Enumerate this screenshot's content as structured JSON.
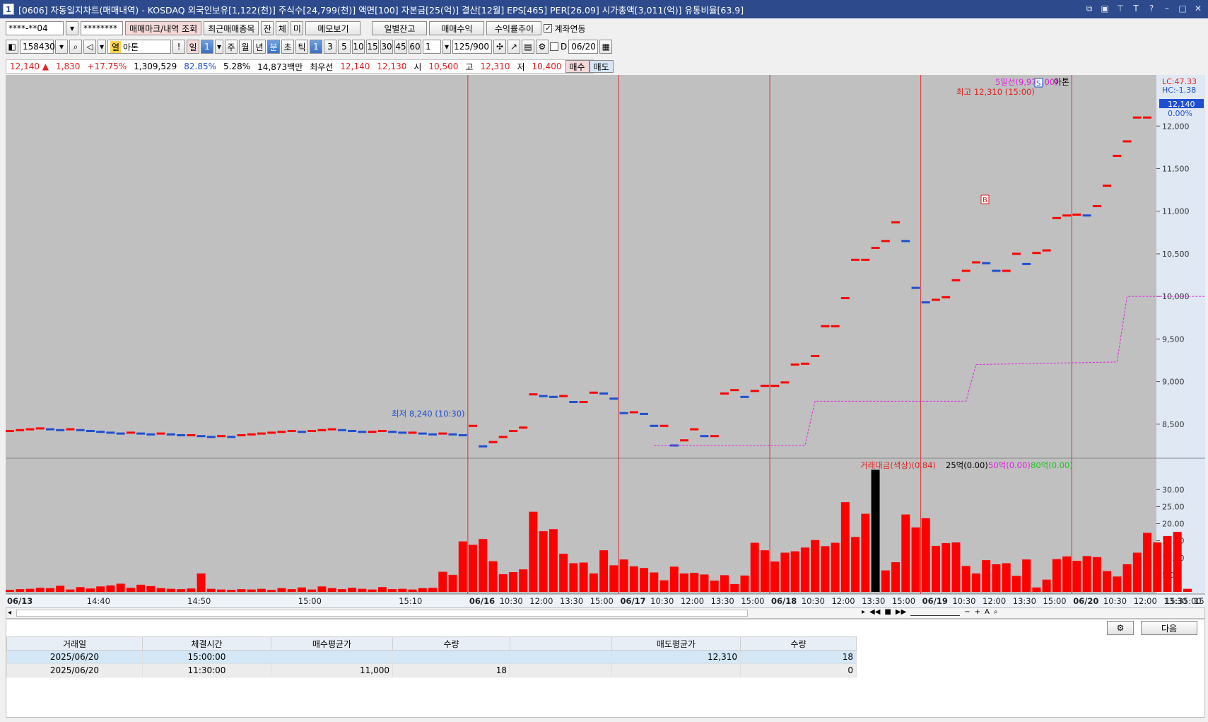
{
  "window": {
    "title": "[0606] 자동일지차트(매매내역) - KOSDAQ 외국인보유[1,122(천)] 주식수[24,799(천)] 액면[100] 자본금[25(억)] 결산[12월] EPS[465] PER[26.09] 시가총액[3,011(억)] 유통비율[63.9]",
    "icon_text": "1"
  },
  "toolbar1": {
    "account": "****-**04",
    "password": "********",
    "query_btn": "매매마크/내역 조회",
    "recent_btn": "최근매매종목",
    "jan_btn": "잔",
    "che_btn": "체",
    "mi_btn": "미",
    "memo_btn": "메모보기",
    "daily_balance_btn": "일별잔고",
    "trade_profit_btn": "매매수익",
    "return_trend_btn": "수익률추이",
    "account_link_label": "계좌연동"
  },
  "toolbar2": {
    "code": "158430",
    "name": "아톤",
    "name_prefix": "열",
    "day_label": "일",
    "period_num": "1",
    "week": "주",
    "month": "월",
    "year": "년",
    "minute": "분",
    "second": "초",
    "tick": "틱",
    "intervals": [
      "1",
      "3",
      "5",
      "10",
      "15",
      "30",
      "45",
      "60"
    ],
    "count": "1",
    "bars": "125/900",
    "date_prefix": "D",
    "date": "06/20"
  },
  "quote": {
    "price": "12,140 ▲",
    "change": "1,830",
    "pct": "+17.75%",
    "volume": "1,309,529",
    "ratio1": "82.85%",
    "ratio2": "5.28%",
    "amount": "14,873백만",
    "best_label": "최우선",
    "ask": "12,140",
    "bid": "12,130",
    "open_label": "시",
    "open": "10,500",
    "high_label": "고",
    "high": "12,310",
    "low_label": "저",
    "low": "10,400",
    "buy_btn": "매수",
    "sell_btn": "매도"
  },
  "chart_data": {
    "type": "candlestick",
    "x_labels": [
      "06/13",
      "14:40",
      "14:50",
      "15:00",
      "15:10",
      "06/16",
      "10:30",
      "12:00",
      "13:30",
      "15:00",
      "06/17",
      "10:30",
      "12:00",
      "13:30",
      "15:00",
      "06/18",
      "10:30",
      "12:00",
      "13:30",
      "15:00",
      "06/19",
      "10:30",
      "12:00",
      "13:30",
      "15:00",
      "06/20",
      "10:30",
      "12:00",
      "13:30",
      "15:00",
      "15:35:00"
    ],
    "price_axis": {
      "ticks": [
        "12,000",
        "11,500",
        "11,000",
        "10,500",
        "10,000",
        "9,500",
        "9,000",
        "8,500"
      ],
      "min": 8150,
      "max": 12550
    },
    "price_tag": "12,140",
    "price_tag_pct": "0.00%",
    "legend_ma": "5일선(9,972.00)",
    "legend_name": "아톤",
    "lc": "LC:47.33",
    "hc": "HC:-1.38",
    "high_label": "최고 12,310 (15:00)",
    "low_label": "최저 8,240 (10:30)",
    "buy_marker": "B",
    "sell_marker": "S",
    "price_series": [
      8420,
      8430,
      8440,
      8450,
      8440,
      8430,
      8440,
      8430,
      8420,
      8410,
      8400,
      8390,
      8400,
      8390,
      8380,
      8390,
      8380,
      8370,
      8370,
      8360,
      8350,
      8360,
      8350,
      8370,
      8380,
      8390,
      8400,
      8410,
      8420,
      8410,
      8420,
      8430,
      8440,
      8430,
      8420,
      8410,
      8410,
      8420,
      8410,
      8400,
      8400,
      8390,
      8380,
      8390,
      8380,
      8370,
      8480,
      8240,
      8290,
      8350,
      8420,
      8460,
      8850,
      8830,
      8820,
      8830,
      8760,
      8760,
      8870,
      8860,
      8800,
      8630,
      8640,
      8620,
      8480,
      8480,
      8250,
      8310,
      8440,
      8360,
      8360,
      8860,
      8900,
      8820,
      8890,
      8950,
      8950,
      8990,
      9200,
      9210,
      9300,
      9650,
      9650,
      9980,
      10430,
      10430,
      10570,
      10650,
      10870,
      10650,
      10100,
      9930,
      9960,
      9990,
      10190,
      10300,
      10400,
      10390,
      10300,
      10300,
      10500,
      10380,
      10510,
      10540,
      10920,
      10950,
      10960,
      10950,
      11060,
      11300,
      11650,
      11820,
      12100,
      12100
    ],
    "ma_series": [
      8250,
      8250,
      9200,
      9230,
      10000,
      10000
    ],
    "volume_axis": {
      "ticks": [
        "30.00",
        "25.00",
        "20.00",
        "15.00",
        "10.00",
        "5.00"
      ],
      "max": 34
    },
    "volume_legend": {
      "name": "거래대금(색상)(0.84)",
      "a": "25억(0.00)",
      "b": "50억(0.00)",
      "c": "80억(0.00)"
    },
    "volume_series": [
      0.6,
      0.8,
      0.9,
      1.2,
      1.1,
      1.8,
      0.7,
      1.4,
      1.0,
      1.6,
      1.9,
      2.4,
      1.2,
      2.1,
      1.7,
      1.1,
      0.9,
      0.8,
      1.0,
      5.4,
      0.9,
      0.7,
      0.6,
      0.8,
      0.7,
      0.9,
      0.6,
      1.1,
      0.8,
      1.3,
      0.7,
      1.6,
      1.1,
      0.8,
      1.2,
      0.9,
      0.7,
      1.4,
      0.8,
      0.9,
      0.7,
      1.1,
      1.2,
      5.9,
      5.0,
      14.8,
      13.8,
      15.5,
      9.0,
      5.2,
      5.8,
      6.6,
      23.5,
      17.8,
      18.4,
      11.2,
      8.4,
      8.6,
      5.4,
      12.2,
      7.8,
      9.5,
      7.5,
      7.0,
      5.7,
      3.4,
      7.4,
      5.4,
      5.6,
      5.1,
      3.3,
      4.9,
      2.3,
      4.8,
      14.4,
      12.2,
      8.9,
      11.5,
      11.9,
      13.0,
      15.2,
      13.4,
      14.4,
      26.3,
      16.1,
      22.9,
      35.8,
      6.3,
      8.7,
      22.7,
      18.9,
      21.6,
      13.5,
      14.3,
      14.5,
      7.6,
      5.4,
      9.3,
      8.1,
      8.4,
      4.7,
      9.5,
      1.3,
      3.6,
      9.6,
      10.4,
      9.1,
      10.5,
      10.2,
      6.1,
      4.5,
      8.1,
      11.5,
      17.3,
      14.5,
      16.4,
      17.6,
      0.9
    ],
    "highlight_bar_index": 86
  },
  "table": {
    "headers": [
      "거래일",
      "체결시간",
      "매수평균가",
      "수량",
      "",
      "매도평균가",
      "수량"
    ],
    "rows": [
      {
        "date": "2025/06/20",
        "time": "15:00:00",
        "buy_avg": "",
        "buy_qty": "",
        "blank": "",
        "sell_avg": "12,310",
        "sell_qty": "18"
      },
      {
        "date": "2025/06/20",
        "time": "11:30:00",
        "buy_avg": "11,000",
        "buy_qty": "18",
        "blank": "",
        "sell_avg": "",
        "sell_qty": "0"
      }
    ],
    "next_btn": "다음"
  },
  "colors": {
    "up": "#ff0000",
    "down": "#1f4fd0",
    "chart_bg": "#c0c0c0",
    "ma": "#e020e0"
  }
}
